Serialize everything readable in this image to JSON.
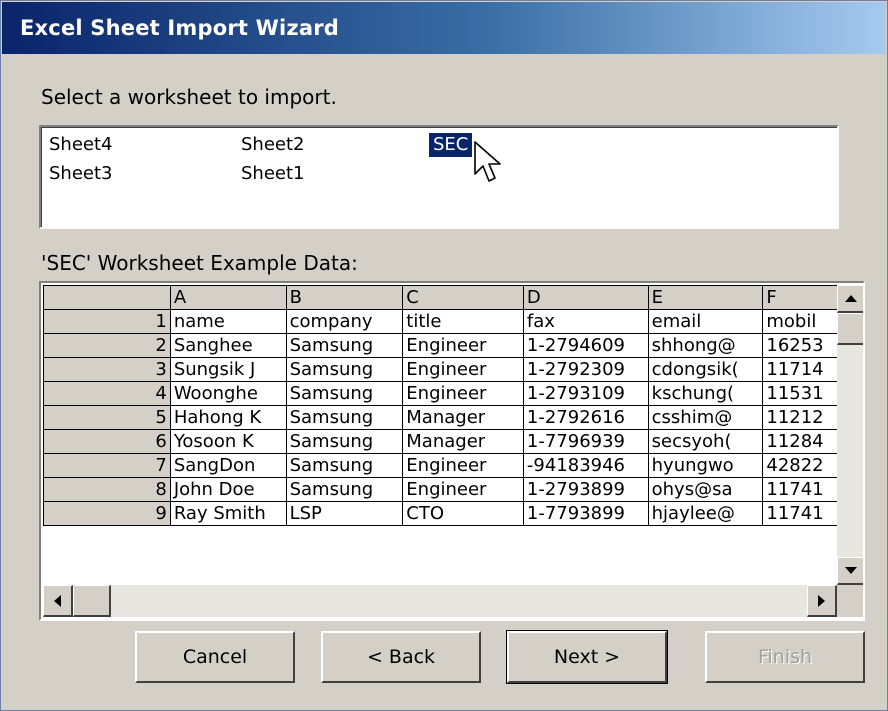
{
  "window": {
    "title": "Excel Sheet Import Wizard"
  },
  "prompt": "Select a worksheet to import.",
  "sheets": [
    {
      "name": "Sheet4",
      "selected": false
    },
    {
      "name": "Sheet2",
      "selected": false
    },
    {
      "name": "SEC",
      "selected": true
    },
    {
      "name": "Sheet3",
      "selected": false
    },
    {
      "name": "Sheet1",
      "selected": false
    }
  ],
  "example_label": "'SEC' Worksheet Example Data:",
  "grid": {
    "columns": [
      "A",
      "B",
      "C",
      "D",
      "E",
      "F"
    ],
    "rows": [
      {
        "num": "1",
        "cells": [
          "name",
          "company",
          "title",
          "fax",
          "email",
          "mobil"
        ]
      },
      {
        "num": "2",
        "cells": [
          "Sanghee",
          "Samsung",
          "Engineer",
          "1-2794609",
          "shhong@",
          "16253"
        ]
      },
      {
        "num": "3",
        "cells": [
          "Sungsik J",
          "Samsung",
          "Engineer",
          "1-2792309",
          "cdongsik(",
          "11714"
        ]
      },
      {
        "num": "4",
        "cells": [
          "Woonghe",
          "Samsung",
          "Engineer",
          "1-2793109",
          "kschung(",
          "11531"
        ]
      },
      {
        "num": "5",
        "cells": [
          "Hahong K",
          "Samsung",
          "Manager",
          "1-2792616",
          "csshim@",
          "11212"
        ]
      },
      {
        "num": "6",
        "cells": [
          "Yosoon K",
          "Samsung",
          "Manager",
          "1-7796939",
          "secsyoh(",
          "11284"
        ]
      },
      {
        "num": "7",
        "cells": [
          "SangDon",
          "Samsung",
          "Engineer",
          "-94183946",
          "hyungwo",
          "42822"
        ]
      },
      {
        "num": "8",
        "cells": [
          "John Doe",
          "Samsung",
          "Engineer",
          "1-2793899",
          "ohys@sa",
          "11741"
        ]
      },
      {
        "num": "9",
        "cells": [
          "Ray Smith",
          "LSP",
          "CTO",
          "1-7793899",
          "hjaylee@",
          "11741"
        ]
      }
    ]
  },
  "buttons": {
    "cancel": "Cancel",
    "back": "< Back",
    "next": "Next >",
    "finish": "Finish"
  },
  "colors": {
    "titlebar_start": "#0a246a",
    "titlebar_end": "#a6caf0",
    "selection": "#0a246a",
    "face": "#d4d0c8"
  }
}
